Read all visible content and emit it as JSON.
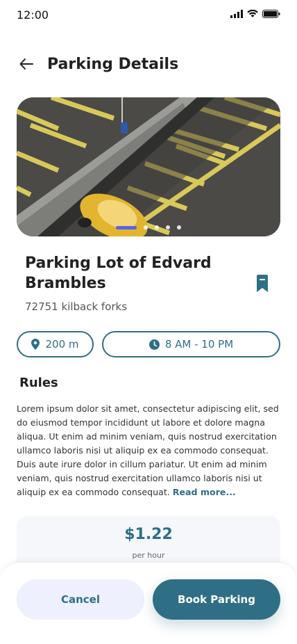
{
  "status_bar": {
    "time": "12:00"
  },
  "header": {
    "title": "Parking Details"
  },
  "carousel": {
    "total": 5,
    "active_index": 0
  },
  "lot": {
    "name": "Parking Lot of Edvard Brambles",
    "address": "72751 kilback forks"
  },
  "chips": {
    "distance": "200 m",
    "hours": "8 AM - 10 PM"
  },
  "rules": {
    "title": "Rules",
    "text": "Lorem ipsum dolor sit amet, consectetur adipiscing elit, sed do eiusmod tempor incididunt ut labore et dolore magna aliqua. Ut enim ad minim veniam, quis nostrud exercitation ullamco laboris nisi ut aliquip ex ea commodo consequat. Duis aute irure dolor in cillum pariatur. Ut enim ad minim veniam, quis nostrud exercitation ullamco laboris nisi ut aliquip ex ea commodo consequat.",
    "read_more": "Read more..."
  },
  "price": {
    "value": "$1.22",
    "unit": "per hour"
  },
  "actions": {
    "cancel": "Cancel",
    "book": "Book Parking"
  },
  "colors": {
    "accent": "#2f6f86",
    "indicator": "#5b63e8",
    "cancel_bg": "#eef0fd"
  }
}
